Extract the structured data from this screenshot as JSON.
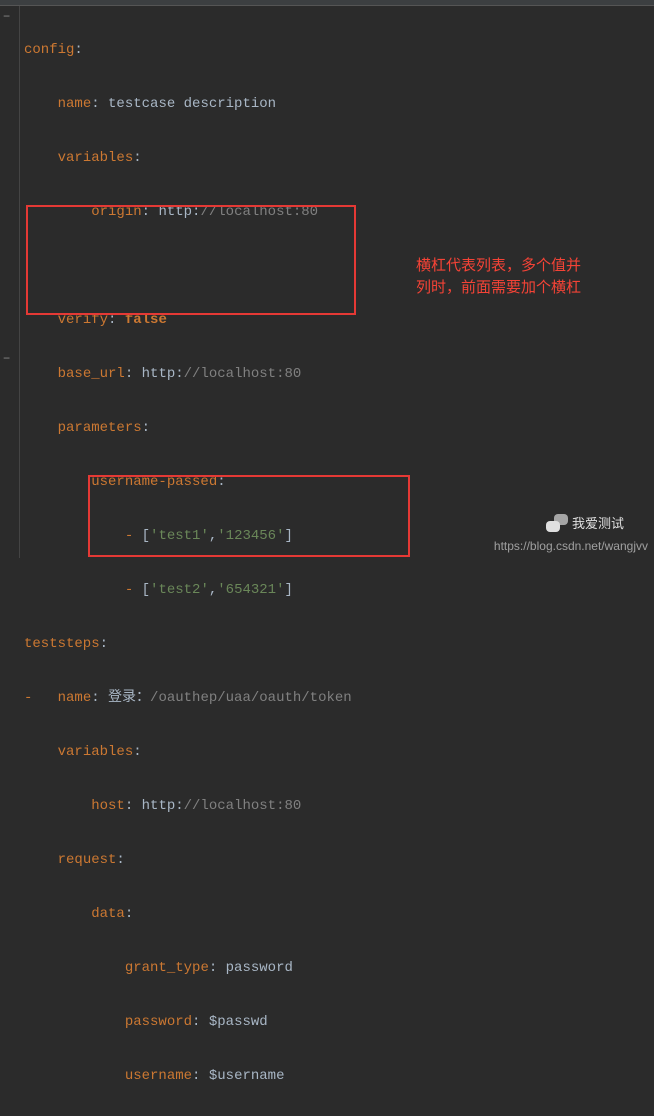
{
  "code": {
    "l1": {
      "k": "config",
      "c": ":"
    },
    "l2": {
      "k": "name",
      "c": ": ",
      "v": "testcase description"
    },
    "l3": {
      "k": "variables",
      "c": ":"
    },
    "l4": {
      "k": "origin",
      "c": ": ",
      "v_pre": "http:",
      "v_cmt": "//localhost:80"
    },
    "l6": {
      "k": "verify",
      "c": ": ",
      "v": "false"
    },
    "l7": {
      "k": "base_url",
      "c": ": ",
      "v_pre": "http:",
      "v_cmt": "//localhost:80"
    },
    "l8": {
      "k": "parameters",
      "c": ":"
    },
    "l9": {
      "k": "username-passed",
      "c": ":"
    },
    "l10": {
      "d": "- ",
      "b1": "[",
      "s1": "'test1'",
      "cm": ",",
      "s2": "'123456'",
      "b2": "]"
    },
    "l11": {
      "d": "- ",
      "b1": "[",
      "s1": "'test2'",
      "cm": ",",
      "s2": "'654321'",
      "b2": "]"
    },
    "l12": {
      "k": "teststeps",
      "c": ":"
    },
    "l13": {
      "d": "-",
      "k": "name",
      "c": ": ",
      "v_pre": "登录：",
      "v_cmt": "/oauthep/uaa/oauth/token"
    },
    "l14": {
      "k": "variables",
      "c": ":"
    },
    "l15": {
      "k": "host",
      "c": ": ",
      "v_pre": "http:",
      "v_cmt": "//localhost:80"
    },
    "l16": {
      "k": "request",
      "c": ":"
    },
    "l17": {
      "k": "data",
      "c": ":"
    },
    "l18": {
      "k": "grant_type",
      "c": ": ",
      "v": "password"
    },
    "l19": {
      "k": "password",
      "c": ": ",
      "v": "$passwd"
    },
    "l20": {
      "k": "username",
      "c": ": ",
      "v": "$username"
    }
  },
  "annotation": {
    "line1": "横杠代表列表，多个值并",
    "line2": "列时，前面需要加个横杠"
  },
  "watermark": {
    "wechat": "我爱测试",
    "url": "https://blog.csdn.net/wangjvv"
  }
}
